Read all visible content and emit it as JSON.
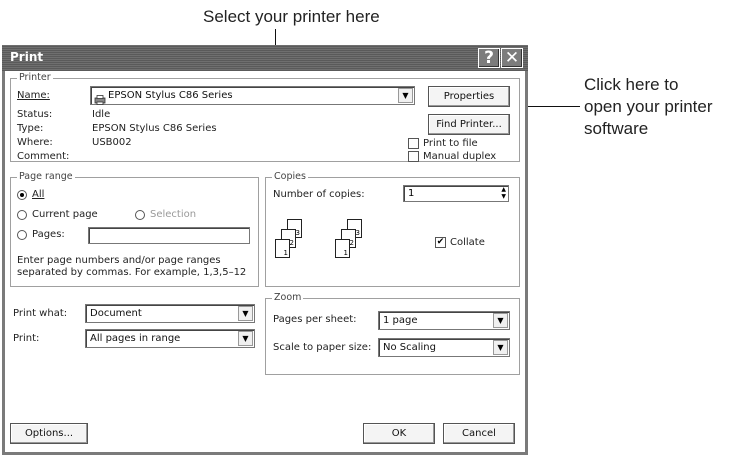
{
  "callouts": {
    "top": "Select your printer here",
    "right_1": "Click here to",
    "right_2": "open your printer",
    "right_3": "software"
  },
  "dialog": {
    "title": "Print",
    "help_glyph": "?",
    "close_glyph": "✕"
  },
  "printer": {
    "group_label": "Printer",
    "name_label": "Name:",
    "name_value": "EPSON Stylus C86 Series",
    "status_label": "Status:",
    "status_value": "Idle",
    "type_label": "Type:",
    "type_value": "EPSON Stylus C86 Series",
    "where_label": "Where:",
    "where_value": "USB002",
    "comment_label": "Comment:",
    "properties_button": "Properties",
    "find_printer_button": "Find Printer...",
    "print_to_file": "Print to file",
    "manual_duplex": "Manual duplex"
  },
  "page_range": {
    "group_label": "Page range",
    "all": "All",
    "current_page": "Current page",
    "selection": "Selection",
    "pages": "Pages:",
    "hint_1": "Enter page numbers and/or page ranges",
    "hint_2": "separated by commas.  For example, 1,3,5–12"
  },
  "copies": {
    "group_label": "Copies",
    "number_label": "Number of copies:",
    "number_value": "1",
    "collate": "Collate",
    "page_labels": [
      "1",
      "2",
      "3"
    ]
  },
  "print_what": {
    "label": "Print what:",
    "value": "Document"
  },
  "print_range": {
    "label": "Print:",
    "value": "All pages in range"
  },
  "zoom": {
    "group_label": "Zoom",
    "pages_per_sheet_label": "Pages per sheet:",
    "pages_per_sheet_value": "1 page",
    "scale_label": "Scale to paper size:",
    "scale_value": "No Scaling"
  },
  "buttons": {
    "options": "Options...",
    "ok": "OK",
    "cancel": "Cancel"
  },
  "glyphs": {
    "dropdown": "▼",
    "check": "✔",
    "spin_up": "▲",
    "spin_down": "▼"
  }
}
